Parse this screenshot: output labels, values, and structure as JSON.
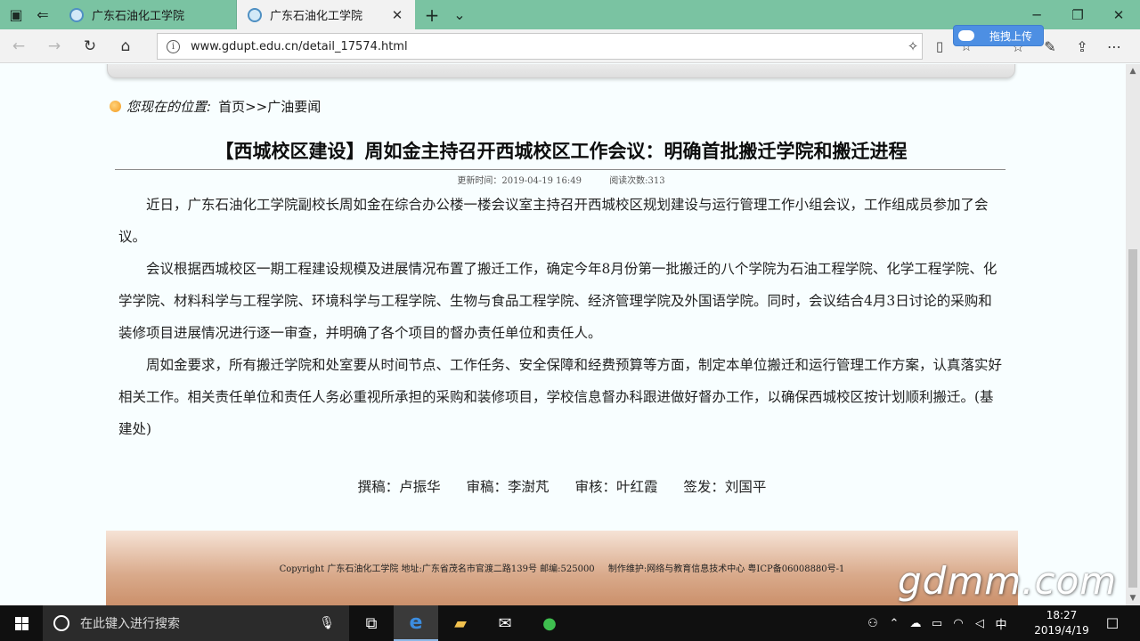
{
  "browser": {
    "tabs": [
      {
        "label": "广东石油化工学院",
        "active": false
      },
      {
        "label": "广东石油化工学院",
        "active": true
      }
    ],
    "new_tab": "+",
    "tab_list": "⌄",
    "url": "www.gdupt.edu.cn/detail_17574.html",
    "upload_button": "拖拽上传"
  },
  "page": {
    "breadcrumb": {
      "label": "您现在的位置:",
      "path": "首页>>广油要闻"
    },
    "article": {
      "title": "【西城校区建设】周如金主持召开西城校区工作会议：明确首批搬迁学院和搬迁进程",
      "updated": "更新时间：2019-04-19 16:49",
      "views": "阅读次数:313",
      "paragraphs": [
        "近日，广东石油化工学院副校长周如金在综合办公楼一楼会议室主持召开西城校区规划建设与运行管理工作小组会议，工作组成员参加了会议。",
        "会议根据西城校区一期工程建设规模及进展情况布置了搬迁工作，确定今年8月份第一批搬迁的八个学院为石油工程学院、化学工程学院、化学学院、材料科学与工程学院、环境科学与工程学院、生物与食品工程学院、经济管理学院及外国语学院。同时，会议结合4月3日讨论的采购和装修项目进展情况进行逐一审查，并明确了各个项目的督办责任单位和责任人。",
        "周如金要求，所有搬迁学院和处室要从时间节点、工作任务、安全保障和经费预算等方面，制定本单位搬迁和运行管理工作方案，认真落实好相关工作。相关责任单位和责任人务必重视所承担的采购和装修项目，学校信息督办科跟进做好督办工作，以确保西城校区按计划顺利搬迁。(基建处)"
      ],
      "signoff": {
        "writer": "撰稿：卢振华",
        "editor": "审稿：李澍芃",
        "reviewer": "审核：叶红霞",
        "issuer": "签发：刘国平"
      }
    },
    "footer": {
      "copyright": "Copyright 广东石油化工学院 地址:广东省茂名市官渡二路139号 邮编:525000",
      "maintainer": "制作维护:网络与教育信息技术中心 粤ICP备06008880号-1"
    },
    "watermark": "gdmm.com"
  },
  "taskbar": {
    "search_placeholder": "在此键入进行搜索",
    "ime": "中",
    "time": "18:27",
    "date": "2019/4/19"
  }
}
